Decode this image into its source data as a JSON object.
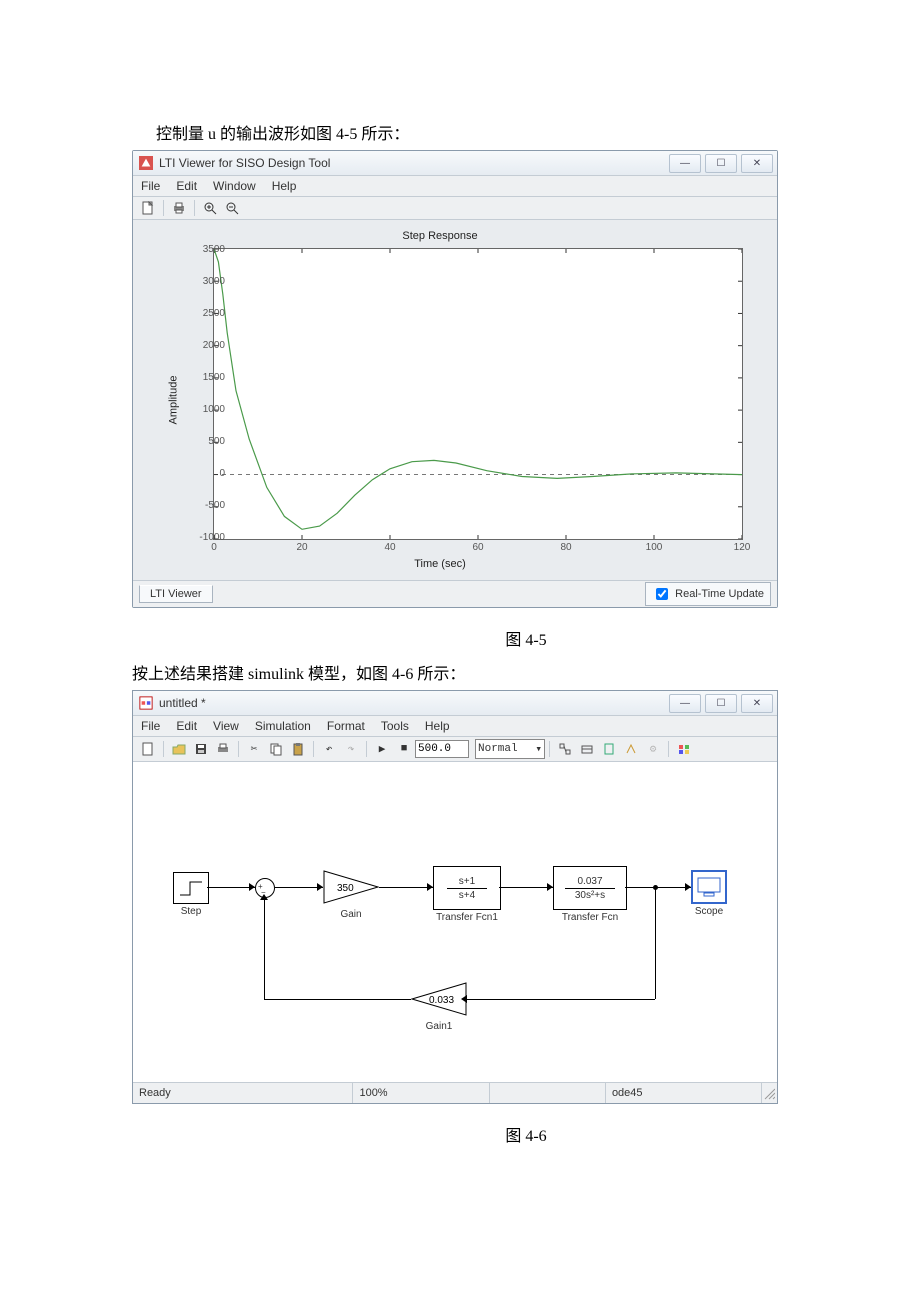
{
  "doc": {
    "para1": "控制量 u 的输出波形如图 4-5 所示：",
    "caption1": "图 4-5",
    "para2": "按上述结果搭建 simulink 模型，如图 4-6 所示：",
    "caption2": "图 4-6"
  },
  "lti": {
    "title": "LTI Viewer for SISO Design Tool",
    "menus": {
      "file": "File",
      "edit": "Edit",
      "window": "Window",
      "help": "Help"
    },
    "footer_tab": "LTI Viewer",
    "rtu_label": "Real-Time Update"
  },
  "chart_data": {
    "type": "line",
    "title": "Step Response",
    "xlabel": "Time (sec)",
    "ylabel": "Amplitude",
    "xlim": [
      0,
      120
    ],
    "ylim": [
      -1000,
      3500
    ],
    "xticks": [
      0,
      20,
      40,
      60,
      80,
      100,
      120
    ],
    "yticks": [
      -1000,
      -500,
      0,
      500,
      1000,
      1500,
      2000,
      2500,
      3000,
      3500
    ],
    "series": [
      {
        "name": "u",
        "x": [
          0,
          1,
          2,
          3,
          5,
          8,
          12,
          16,
          20,
          24,
          28,
          32,
          36,
          40,
          45,
          50,
          55,
          62,
          70,
          78,
          86,
          95,
          105,
          120
        ],
        "y": [
          3500,
          3300,
          2800,
          2200,
          1300,
          550,
          -200,
          -650,
          -850,
          -800,
          -600,
          -320,
          -80,
          90,
          200,
          220,
          180,
          60,
          -30,
          -60,
          -30,
          10,
          25,
          0
        ]
      }
    ],
    "zero_line": true
  },
  "simulink": {
    "title": "untitled *",
    "menus": {
      "file": "File",
      "edit": "Edit",
      "view": "View",
      "simulation": "Simulation",
      "format": "Format",
      "tools": "Tools",
      "help": "Help"
    },
    "simtime": "500.0",
    "mode": "Normal",
    "status": {
      "ready": "Ready",
      "zoom": "100%",
      "solver": "ode45"
    },
    "blocks": {
      "step": "Step",
      "gain_val": "350",
      "gain_lbl": "Gain",
      "tf1_num": "s+1",
      "tf1_den": "s+4",
      "tf1_lbl": "Transfer Fcn1",
      "tf2_num": "0.037",
      "tf2_den": "30s²+s",
      "tf2_lbl": "Transfer Fcn",
      "scope": "Scope",
      "gain1_val": "0.033",
      "gain1_lbl": "Gain1"
    }
  }
}
